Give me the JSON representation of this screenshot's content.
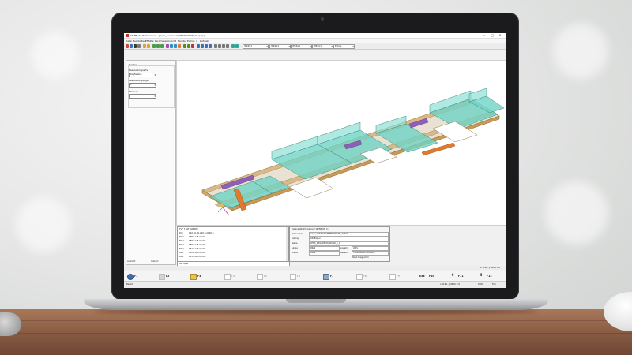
{
  "window": {
    "title": "StaffNetz Professional - [C:\\cs_austausch\\TEST\\WAND_1\\.cpsp]",
    "minimize": "–",
    "maximize": "□",
    "close": "×"
  },
  "menu": [
    "Datei",
    "Bearbeiten",
    "Effekte",
    "Parameter",
    "Ansicht",
    "Fenster",
    "Extras",
    "?",
    "Refresh"
  ],
  "toolbar_combos": [
    "[PR]LV1",
    "[PR]LV1",
    "[PR]LV1",
    "[PR]LV1",
    "Extras"
  ],
  "left_panel": {
    "header": "Suchen",
    "field1_label": "Bearbeitungsarts",
    "field1_value": "Kopfleisten",
    "field2_label": "Bearbeitungslage",
    "field2_value": "1",
    "field3_label": "Element",
    "field3_value": "",
    "footer_label": "Ansicht",
    "footer_value": "Isdeint"
  },
  "list_panel": {
    "header": "TVF  7.8LT    SLBM03",
    "rows": [
      {
        "code": "DIB",
        "text": "102.50,30,240,0,2006,0"
      },
      {
        "code": "BOV",
        "text": "0882,125,00,00,"
      },
      {
        "code": "BOV",
        "text": "0882,125,00,00,"
      },
      {
        "code": "BOV",
        "text": "0882,125,00,00,"
      },
      {
        "code": "BOV",
        "text": "0822,125,00,00,"
      },
      {
        "code": "BOV",
        "text": "0822,125,00,00,"
      },
      {
        "code": "BOV",
        "text": "0817,125,00,00,"
      }
    ],
    "command_line": "Auft Oper"
  },
  "info_panel": {
    "header": "Datensatzinformation / WENSION 2.2",
    "rows": [
      {
        "label": "Datenname",
        "value": "C:\\cs_AUSTAUSCH\\TEST\\WAND_1\\.SUP"
      },
      {
        "label": "Auftrag",
        "value": "2006Spiel"
      },
      {
        "label": "Name",
        "value": "LENA_2BIG_DEMO_WAND_0_1"
      },
      {
        "label": "Länge",
        "value": "9622"
      },
      {
        "label": "Breite",
        "value": "2000"
      }
    ],
    "extra_label": "Anzahl",
    "extra_value": "WRS",
    "bez_label": "Bezeich",
    "bez_value": "VERBINDER HOLZBAU",
    "footer": "Wand-Diagramm"
  },
  "status_top": "x 1196, y 3660, z 0",
  "fkeys": [
    {
      "label": "F1",
      "icon": "help-icon",
      "active": true
    },
    {
      "label": "F2",
      "icon": "cut-icon",
      "active": true
    },
    {
      "label": "F3",
      "icon": "folder-icon",
      "active": true
    },
    {
      "label": "F4",
      "icon": "blank-icon",
      "active": false
    },
    {
      "label": "F5",
      "icon": "blank-icon",
      "active": false
    },
    {
      "label": "F6",
      "icon": "blank-icon",
      "active": false
    },
    {
      "label": "F7",
      "icon": "machine-icon",
      "active": true
    },
    {
      "label": "F8",
      "icon": "blank-icon",
      "active": false
    },
    {
      "label": "F9",
      "icon": "blank-icon",
      "active": false
    },
    {
      "label": "F10",
      "icon": "exit-icon",
      "active": true,
      "prefix": "EXE"
    },
    {
      "label": "F11",
      "icon": "arrow-up-icon",
      "active": true
    },
    {
      "label": "F12",
      "icon": "arrow-down-icon",
      "active": true
    }
  ],
  "status_bottom": {
    "left": "Bereit",
    "coords": "x 1196, y 3660, z 0",
    "count": "5682",
    "mode": "Full"
  },
  "colors": {
    "panel_fill": "#6fd3c6",
    "frame_wood": "#d9b98a",
    "accent_purple": "#8e5fb8",
    "accent_orange": "#e07a2e"
  }
}
